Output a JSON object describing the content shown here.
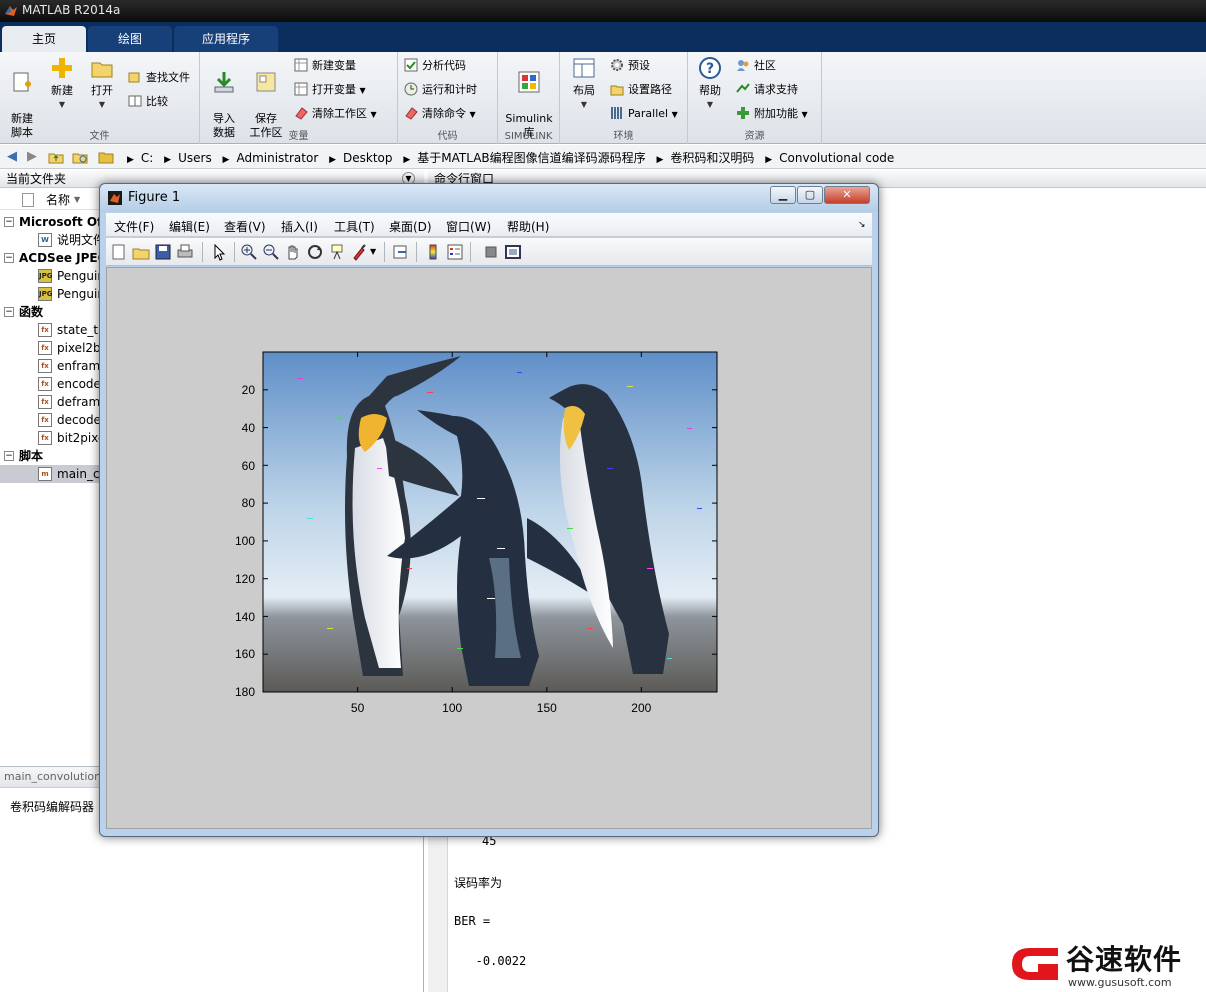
{
  "app": {
    "title": "MATLAB R2014a"
  },
  "tabs": [
    {
      "label": "主页",
      "active": true
    },
    {
      "label": "绘图",
      "active": false
    },
    {
      "label": "应用程序",
      "active": false
    }
  ],
  "ribbon": {
    "file": {
      "group": "文件",
      "new_script": "新建\n脚本",
      "new": "新建",
      "open": "打开",
      "find_files": "查找文件",
      "compare": "比较"
    },
    "variable": {
      "group": "变量",
      "import": "导入\n数据",
      "save_ws": "保存\n工作区",
      "new_var": "新建变量",
      "open_var": "打开变量",
      "clear_ws": "清除工作区"
    },
    "code": {
      "group": "代码",
      "analyze": "分析代码",
      "run_time": "运行和计时",
      "clear_cmd": "清除命令"
    },
    "simulink": {
      "group": "SIMULINK",
      "lib": "Simulink\n库"
    },
    "env": {
      "group": "环境",
      "layout": "布局",
      "prefs": "预设",
      "set_path": "设置路径",
      "parallel": "Parallel"
    },
    "resources": {
      "group": "资源",
      "help": "帮助",
      "community": "社区",
      "support": "请求支持",
      "addons": "附加功能"
    }
  },
  "address": {
    "crumbs": [
      "C:",
      "Users",
      "Administrator",
      "Desktop",
      "基于MATLAB编程图像信道编译码源码程序",
      "卷积码和汉明码",
      "Convolutional code"
    ]
  },
  "left_panel": {
    "title": "当前文件夹",
    "col_name": "名称",
    "tree": [
      {
        "label": "Microsoft Office",
        "cat": true
      },
      {
        "label": "说明文件",
        "icon": "W"
      },
      {
        "label": "ACDSee JPEG",
        "cat": true
      },
      {
        "label": "Penguins",
        "icon": "JPG"
      },
      {
        "label": "Penguins",
        "icon": "JPG"
      },
      {
        "label": "函数",
        "cat": true
      },
      {
        "label": "state_tr",
        "icon": "fx"
      },
      {
        "label": "pixel2b",
        "icon": "fx"
      },
      {
        "label": "enfram",
        "icon": "fx"
      },
      {
        "label": "encode",
        "icon": "fx"
      },
      {
        "label": "defram",
        "icon": "fx"
      },
      {
        "label": "decode",
        "icon": "fx"
      },
      {
        "label": "bit2pixe",
        "icon": "fx"
      },
      {
        "label": "脚本",
        "cat": true
      },
      {
        "label": "main_co",
        "icon": "m",
        "selected": true
      }
    ],
    "details_title": "main_convolution",
    "details_text": "卷积码编解码器"
  },
  "command": {
    "title": "命令行窗口",
    "lines": [
      "45",
      "误码率为",
      "BER =",
      "   -0.0022"
    ]
  },
  "figure": {
    "title": "Figure 1",
    "menus": [
      "文件(F)",
      "编辑(E)",
      "查看(V)",
      "插入(I)",
      "工具(T)",
      "桌面(D)",
      "窗口(W)",
      "帮助(H)"
    ],
    "y_ticks": [
      "20",
      "40",
      "60",
      "80",
      "100",
      "120",
      "140",
      "160",
      "180"
    ],
    "x_ticks": [
      "50",
      "100",
      "150",
      "200"
    ]
  },
  "watermark": {
    "text": "谷速软件",
    "url": "www.gususoft.com"
  }
}
